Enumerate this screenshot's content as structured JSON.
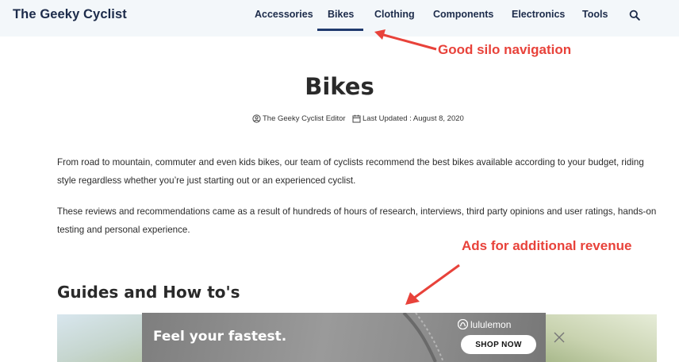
{
  "site": {
    "name": "The Geeky Cyclist"
  },
  "nav": {
    "items": [
      "Accessories",
      "Bikes",
      "Clothing",
      "Components",
      "Electronics",
      "Tools"
    ],
    "active": "Bikes"
  },
  "icons": {
    "search": "search-icon",
    "author": "user-circle-icon",
    "calendar": "calendar-icon",
    "close": "close-icon"
  },
  "annotations": {
    "nav": "Good silo navigation",
    "ads": "Ads for additional revenue"
  },
  "article": {
    "title": "Bikes",
    "author": "The Geeky Cyclist Editor",
    "updated": "Last Updated : August 8, 2020",
    "intro": "From road to mountain, commuter and even kids bikes, our team of cyclists recommend the best bikes available according to your budget, riding style regardless whether you’re just starting out or an experienced cyclist.",
    "research": "These reviews and recommendations came as a result of hundreds of hours of research, interviews, third party opinions and user ratings, hands-on testing and personal experience.",
    "section_heading": "Guides and How to's"
  },
  "ad": {
    "headline": "Feel your fastest.",
    "brand": "lululemon",
    "cta": "SHOP NOW"
  },
  "colors": {
    "accent": "#1f3a6e",
    "annotation": "#e8423a",
    "header_bg": "#f3f7fa"
  }
}
